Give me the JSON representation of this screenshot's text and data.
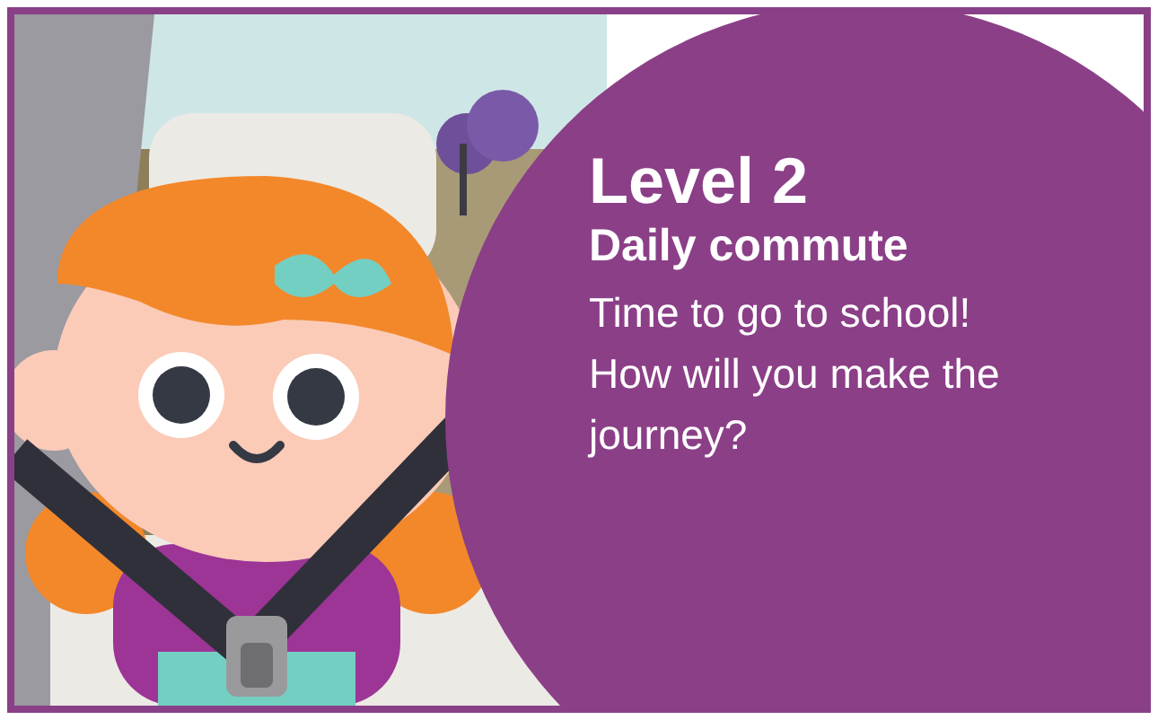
{
  "level": {
    "title": "Level 2",
    "subtitle": "Daily commute",
    "text": "Time to go to school! How will you make the journey?"
  }
}
